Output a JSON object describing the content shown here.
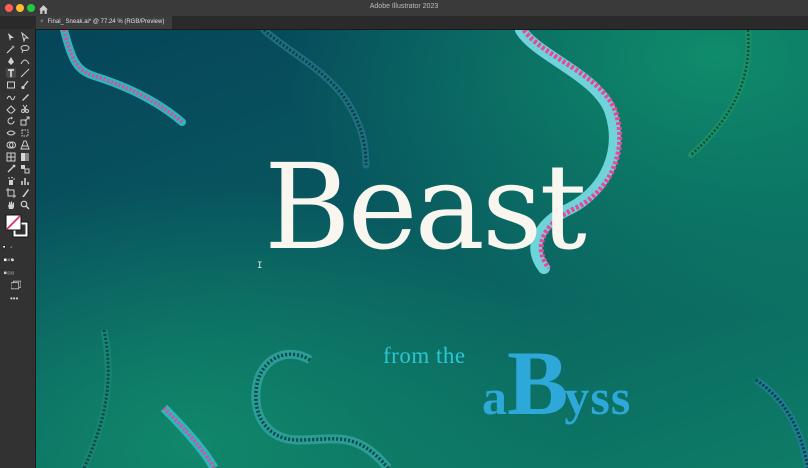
{
  "window": {
    "app_title": "Adobe Illustrator 2023"
  },
  "document_tab": {
    "close_glyph": "×",
    "label": "Final_ Sneak.ai* @ 77.24 % (RGB/Preview)"
  },
  "toolbar": {
    "tools": [
      "selection-tool",
      "direct-selection-tool",
      "magic-wand-tool",
      "lasso-tool",
      "pen-tool",
      "curvature-tool",
      "type-tool",
      "line-segment-tool",
      "rectangle-tool",
      "paintbrush-tool",
      "shaper-tool",
      "pencil-tool",
      "eraser-tool",
      "scissors-tool",
      "rotate-tool",
      "scale-tool",
      "width-tool",
      "free-transform-tool",
      "shape-builder-tool",
      "perspective-grid-tool",
      "mesh-tool",
      "gradient-tool",
      "eyedropper-tool",
      "blend-tool",
      "symbol-sprayer-tool",
      "column-graph-tool",
      "artboard-tool",
      "slice-tool",
      "hand-tool",
      "zoom-tool"
    ],
    "edit_toolbar_glyph": "•••"
  },
  "artwork": {
    "headline": "Beast",
    "subtitle_prefix": "from the",
    "subtitle_a": "a",
    "subtitle_b": "B",
    "subtitle_yss": "yss",
    "text_cursor_glyph": "I"
  },
  "colors": {
    "canvas_dark": "#06455a",
    "canvas_light": "#0e7c66",
    "headline": "#f8f6ef",
    "subtitle": "#2ea7d9",
    "tentacle_pink": "#e8479a",
    "tentacle_teal": "#2ab8bf"
  }
}
